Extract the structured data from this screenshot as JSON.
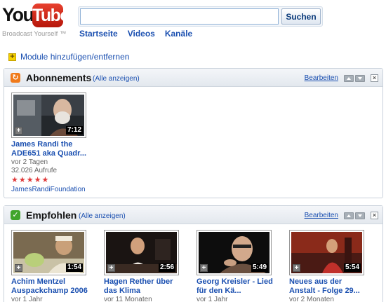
{
  "header": {
    "logo_you": "You",
    "logo_tube": "Tube",
    "logo_tagline": "Broadcast Yourself ™",
    "search": {
      "value": "",
      "button_label": "Suchen"
    },
    "nav": [
      {
        "label": "Startseite"
      },
      {
        "label": "Videos"
      },
      {
        "label": "Kanäle"
      }
    ]
  },
  "module_toggle_label": "Module hinzufügen/entfernen",
  "modules": [
    {
      "title": "Abonnements",
      "show_all": "(Alle anzeigen)",
      "edit": "Bearbeiten",
      "icon": "subscriptions-icon",
      "accent": "#f07a1a",
      "videos": [
        {
          "title_line1": "James Randi the",
          "title_line2": "ADE651 aka Quadr...",
          "age": "vor 2 Tagen",
          "views": "32.026 Aufrufe",
          "rating_stars": 5,
          "user": "JamesRandiFoundation",
          "duration": "7:12"
        }
      ]
    },
    {
      "title": "Empfohlen",
      "show_all": "(Alle anzeigen)",
      "edit": "Bearbeiten",
      "icon": "recommended-icon",
      "accent": "#41a52b",
      "videos": [
        {
          "title_line1": "Achim Mentzel",
          "title_line2": "Auspackchamp 2006",
          "age": "vor 1 Jahr",
          "duration": "1:54"
        },
        {
          "title_line1": "Hagen Rether über",
          "title_line2": "das Klima",
          "age": "vor 11 Monaten",
          "duration": "2:56"
        },
        {
          "title_line1": "Georg Kreisler - Lied",
          "title_line2": "für den Kä...",
          "age": "vor 1 Jahr",
          "duration": "5:49"
        },
        {
          "title_line1": "Neues aus der",
          "title_line2": "Anstalt - Folge 29...",
          "age": "vor 2 Monaten",
          "duration": "5:54"
        }
      ]
    }
  ]
}
